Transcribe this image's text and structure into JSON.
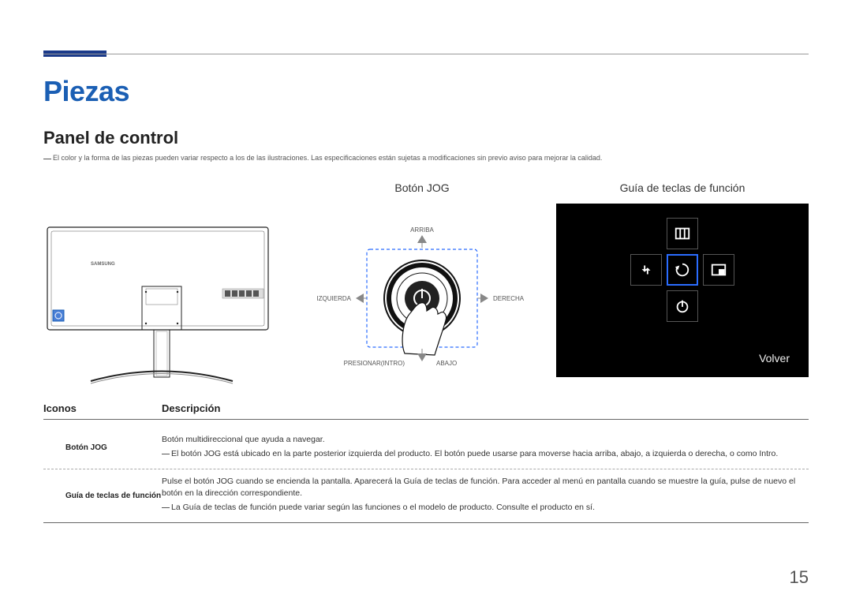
{
  "page": {
    "section_title": "Piezas",
    "sub_title": "Panel de control",
    "note": "El color y la forma de las piezas pueden variar respecto a los de las ilustraciones. Las especificaciones están sujetas a modificaciones sin previo aviso para mejorar la calidad.",
    "page_number": "15"
  },
  "illus": {
    "monitor_brand": "SAMSUNG",
    "jog_title": "Botón JOG",
    "guide_title": "Guía de teclas de función",
    "jog_labels": {
      "up": "ARRIBA",
      "left": "IZQUIERDA",
      "right": "DERECHA",
      "down": "ABAJO",
      "press": "PRESIONAR(INTRO)"
    },
    "guide_volver": "Volver"
  },
  "table": {
    "header_icons": "Iconos",
    "header_desc": "Descripción",
    "rows": [
      {
        "name": "Botón JOG",
        "line1": "Botón multidireccional que ayuda a navegar.",
        "note": "El botón JOG está ubicado en la parte posterior izquierda del producto. El botón puede usarse para moverse hacia arriba, abajo, a izquierda o derecha, o como Intro."
      },
      {
        "name": "Guía de teclas de función",
        "line1": "Pulse el botón JOG cuando se encienda la pantalla. Aparecerá la Guía de teclas de función. Para acceder al menú en pantalla cuando se muestre la guía, pulse de nuevo el botón en la dirección correspondiente.",
        "note": "La Guía de teclas de función puede variar según las funciones o el modelo de producto. Consulte el producto en sí."
      }
    ]
  }
}
